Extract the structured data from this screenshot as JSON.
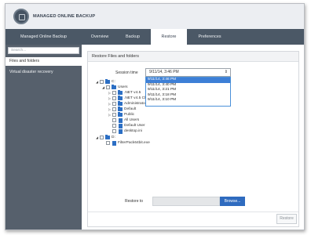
{
  "app": {
    "title": "MANAGED ONLINE BACKUP"
  },
  "nav": {
    "brand": "Managed Online Backup",
    "tabs": [
      "Overview",
      "Backup",
      "Restore",
      "Preferences"
    ],
    "active": "Restore"
  },
  "sidebar": {
    "search_placeholder": "Search...",
    "items": [
      "Files and folders",
      "Virtual disaster recovery"
    ]
  },
  "panel": {
    "title": "Restore Files and folders",
    "session_label": "Session time",
    "session_value": "9/11/14, 3:46 PM",
    "session_options": [
      "9/11/14, 3:46 PM",
      "9/11/14, 3:40 PM",
      "9/11/14, 3:21 PM",
      "9/11/14, 3:18 PM",
      "9/11/14, 3:10 PM"
    ],
    "restore_to_label": "Restore to",
    "browse_label": "Browse...",
    "restore_button": "Restore"
  },
  "tree": {
    "c_drive": "C:",
    "users": "Users",
    "net45": ".NET v4.5",
    "net45c": ".NET v4.5 Cla",
    "administrator": "Administrator",
    "default": "Default",
    "public": "Public",
    "all_users": "All Users",
    "default_user": "Default User",
    "desktop_ini": "desktop.ini",
    "d_drive": "D:",
    "filter_pack": "FilterPack64bit.exe"
  },
  "colors": {
    "nav_bg": "#4b5866",
    "sidebar_bg": "#56606c",
    "accent": "#2f6bbf",
    "selection": "#3d7fd6",
    "folder": "#2c6fc4"
  }
}
